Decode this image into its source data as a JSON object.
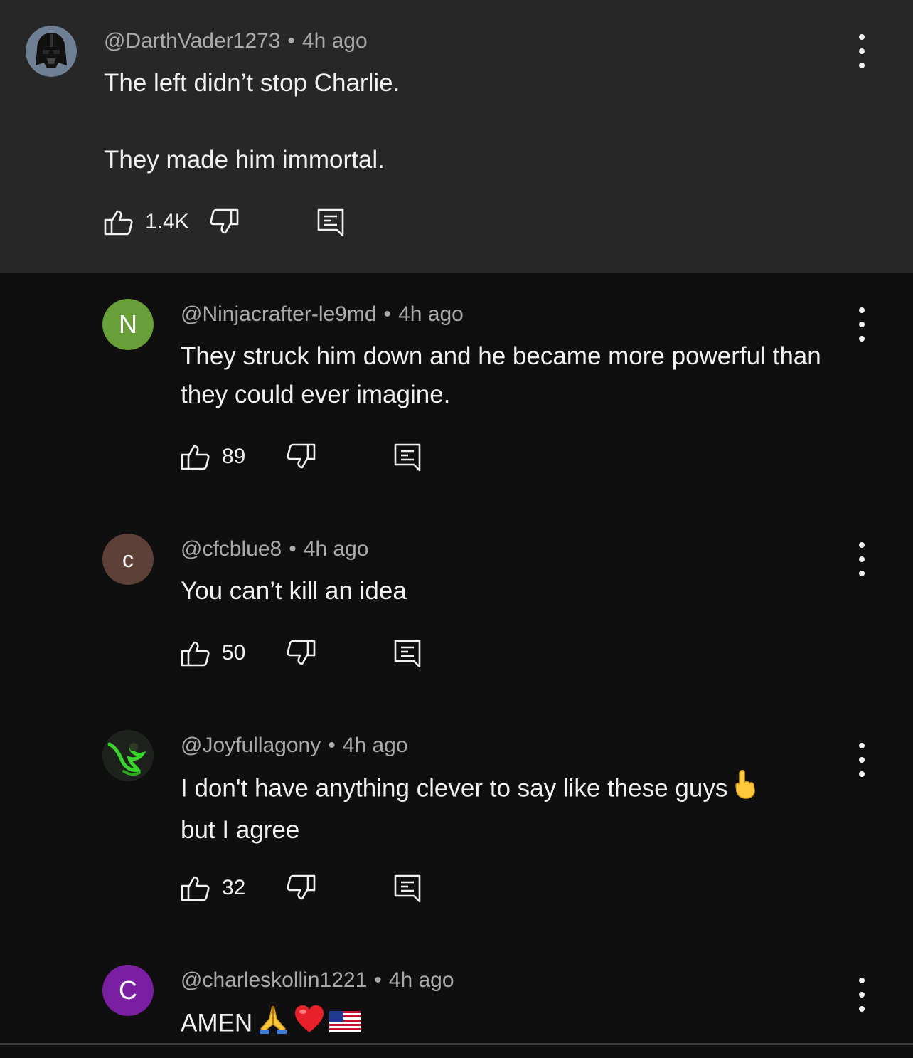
{
  "comments": [
    {
      "author": "@DarthVader1273",
      "time": "4h ago",
      "text": "The left didn’t stop Charlie.\n\nThey made him immortal.",
      "likes": "1.4K",
      "avatar_icon": "darth-vader-avatar-icon"
    },
    {
      "author": "@Ninjacrafter-le9md",
      "time": "4h ago",
      "text": "They struck him down and he became more powerful than they could ever imagine.",
      "likes": "89",
      "avatar_letter": "N",
      "avatar_color": "#689f38"
    },
    {
      "author": "@cfcblue8",
      "time": "4h ago",
      "text": "You can’t kill an idea",
      "likes": "50",
      "avatar_letter": "c",
      "avatar_color": "#5d4037"
    },
    {
      "author": "@Joyfullagony",
      "time": "4h ago",
      "text": "I don't have anything clever to say like these guys",
      "text_line2": "but I agree",
      "likes": "32",
      "avatar_icon": "green-creature-avatar-icon"
    },
    {
      "author": "@charleskollin1221",
      "time": "4h ago",
      "text": "AMEN",
      "avatar_letter": "C",
      "avatar_color": "#7b1fa2"
    }
  ],
  "separator": "•",
  "colors": {
    "highlight_bg": "#272727",
    "page_bg": "#0f0f0f",
    "meta_text": "#aaaaaa"
  }
}
